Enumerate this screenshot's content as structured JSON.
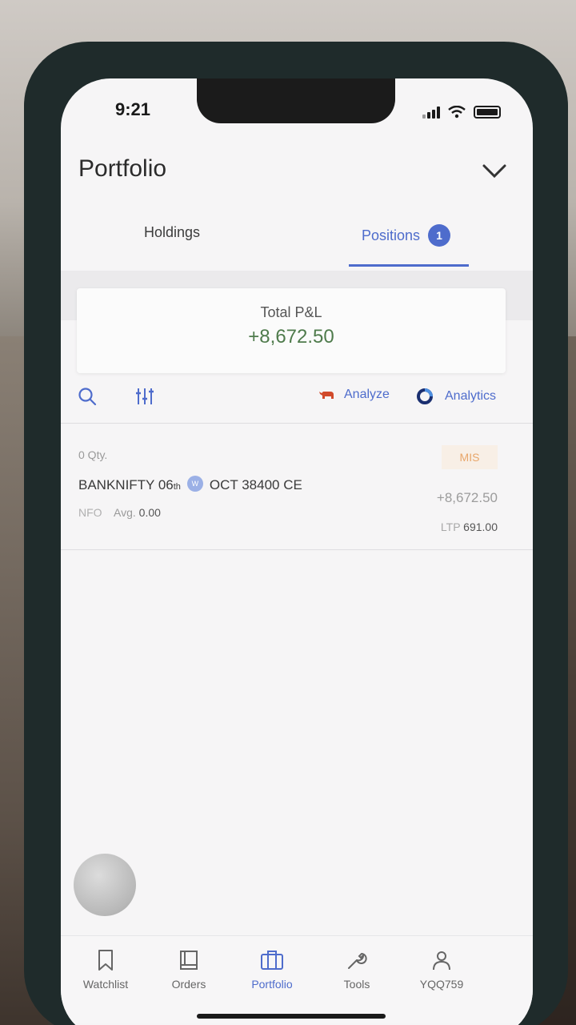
{
  "status_bar": {
    "time": "9:21"
  },
  "header": {
    "title": "Portfolio"
  },
  "tabs": [
    {
      "label": "Holdings",
      "active": false
    },
    {
      "label": "Positions",
      "active": true,
      "badge": "1"
    }
  ],
  "summary": {
    "label": "Total P&L",
    "value": "+8,672.50"
  },
  "toolbar": {
    "search_icon": "search-icon",
    "filter_icon": "sliders-icon",
    "analyze_label": "Analyze",
    "analytics_label": "Analytics"
  },
  "positions": [
    {
      "qty": "0 Qty.",
      "product": "MIS",
      "symbol": "BANKNIFTY 06",
      "day_suffix": "th",
      "weekly_badge": "W",
      "contract": "OCT 38400 CE",
      "pnl": "+8,672.50",
      "exchange": "NFO",
      "avg_label": "Avg.",
      "avg_value": "0.00",
      "ltp_label": "LTP",
      "ltp_value": "691.00"
    }
  ],
  "bottom_nav": [
    {
      "label": "Watchlist",
      "icon": "bookmark-icon"
    },
    {
      "label": "Orders",
      "icon": "book-icon"
    },
    {
      "label": "Portfolio",
      "icon": "briefcase-icon",
      "active": true
    },
    {
      "label": "Tools",
      "icon": "wrench-icon"
    },
    {
      "label": "YQQ759",
      "icon": "user-icon"
    }
  ],
  "colors": {
    "accent": "#4e6ccc",
    "profit": "#4f7b4c",
    "mis": "#e8a66a"
  }
}
